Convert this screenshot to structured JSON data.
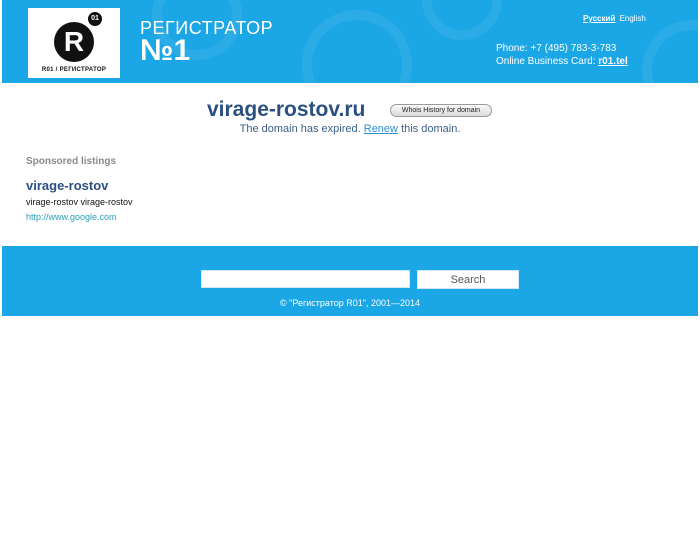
{
  "header": {
    "logo_letter": "R",
    "logo_badge": "01",
    "logo_caption": "R01 / РЕГИСТРАТОР",
    "brand_line1": "РЕГИСТРАТОР",
    "brand_line2": "№1",
    "lang_ru": "Русский",
    "lang_en": "English",
    "phone": "Phone: +7 (495) 783-3-783",
    "card_label": "Online Business Card:",
    "card_link": "r01.tel"
  },
  "main": {
    "domain": "virage-rostov.ru",
    "whois_label": "Whois History for domain",
    "expired_prefix": "The domain has expired.",
    "renew_label": "Renew",
    "expired_suffix": "this domain."
  },
  "sponsored": {
    "title": "Sponsored listings",
    "items": [
      {
        "title": "virage-rostov",
        "description": "virage-rostov virage-rostov",
        "url": "http://www.google.com"
      }
    ]
  },
  "footer": {
    "search_value": "",
    "search_button": "Search",
    "copyright": "© \"Регистратор R01\", 2001—2014"
  },
  "colors": {
    "brand_blue": "#1ba6e6",
    "domain_text": "#2a5080",
    "link": "#2a8fd0"
  }
}
